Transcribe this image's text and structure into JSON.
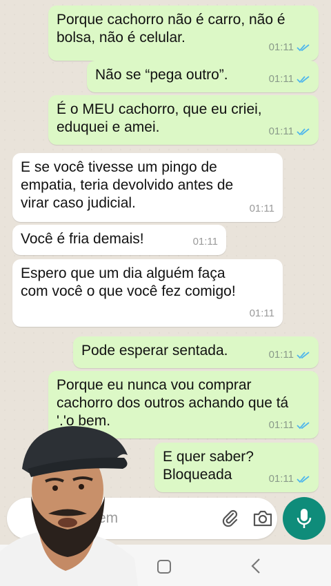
{
  "messages": [
    {
      "dir": "out",
      "text": "Porque cachorro não é carro, não é\nbolsa, não é celular.",
      "time": "01:11"
    },
    {
      "dir": "out",
      "text": "Não se “pega outro”.",
      "time": "01:11"
    },
    {
      "dir": "out",
      "text": "É o MEU cachorro, que eu criei,\neduquei e amei.",
      "time": "01:11"
    },
    {
      "dir": "in",
      "text": "E se você tivesse um pingo de\nempatia, teria devolvido antes de\nvirar caso judicial.",
      "time": "01:11"
    },
    {
      "dir": "in",
      "text": "Você é fria demais!",
      "time": "01:11"
    },
    {
      "dir": "in",
      "text": "Espero que um dia alguém faça\ncom você o que você fez comigo!",
      "time": "01:11"
    },
    {
      "dir": "out",
      "text": "Pode esperar sentada.",
      "time": "01:11"
    },
    {
      "dir": "out",
      "text": "Porque eu nunca vou comprar\ncachorro dos outros achando que tá\n'.'o bem.",
      "time": "01:11"
    },
    {
      "dir": "out",
      "text": "E quer saber?\nBloqueada",
      "time": "01:11"
    }
  ],
  "input": {
    "placeholder": "em"
  },
  "icons": {
    "read_ticks": "double-check-icon",
    "attach": "paperclip-icon",
    "camera": "camera-icon",
    "mic": "microphone-icon",
    "home": "home-square-icon",
    "back": "back-chevron-icon"
  },
  "colors": {
    "outgoing_bubble": "#dcf8c6",
    "incoming_bubble": "#ffffff",
    "chat_bg": "#e9e3da",
    "accent": "#0f8c7a",
    "read_ticks": "#4fb6ec"
  }
}
